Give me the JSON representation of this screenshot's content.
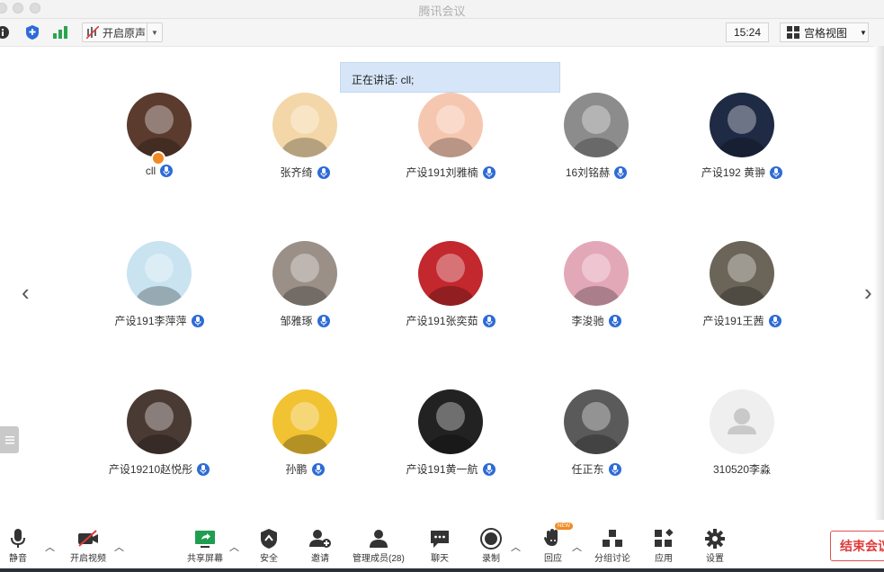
{
  "window": {
    "title": "腾讯会议"
  },
  "toolbar": {
    "audio_label": "开启原声",
    "time": "15:24",
    "view_label": "宫格视图"
  },
  "speaking": {
    "text": "正在讲话: cll;"
  },
  "participants": [
    {
      "name": "cll",
      "host": true
    },
    {
      "name": "张齐绮"
    },
    {
      "name": "产设191刘雅楠"
    },
    {
      "name": "16刘铭赫"
    },
    {
      "name": "产设192 黄翀"
    },
    {
      "name": "产设191李萍萍"
    },
    {
      "name": "邹雅琢"
    },
    {
      "name": "产设191张奕茹"
    },
    {
      "name": "李浚驰"
    },
    {
      "name": "产设191王茜"
    },
    {
      "name": "产设19210赵悦彤"
    },
    {
      "name": "孙鹏"
    },
    {
      "name": "产设191黄一航"
    },
    {
      "name": "任正东"
    },
    {
      "name": "310520李淼"
    }
  ],
  "bottom": {
    "mute": "静音",
    "video": "开启视频",
    "share": "共享屏幕",
    "security": "安全",
    "invite": "邀请",
    "members": "管理成员(28)",
    "chat": "聊天",
    "record": "录制",
    "reaction": "回应",
    "reaction_badge": "NEW",
    "breakout": "分组讨论",
    "apps": "应用",
    "settings": "设置",
    "end": "结束会议"
  },
  "colors": {
    "accent": "#2d6bd7",
    "end": "#e03a3a",
    "banner": "#d6e6f8",
    "host": "#f08a24"
  }
}
